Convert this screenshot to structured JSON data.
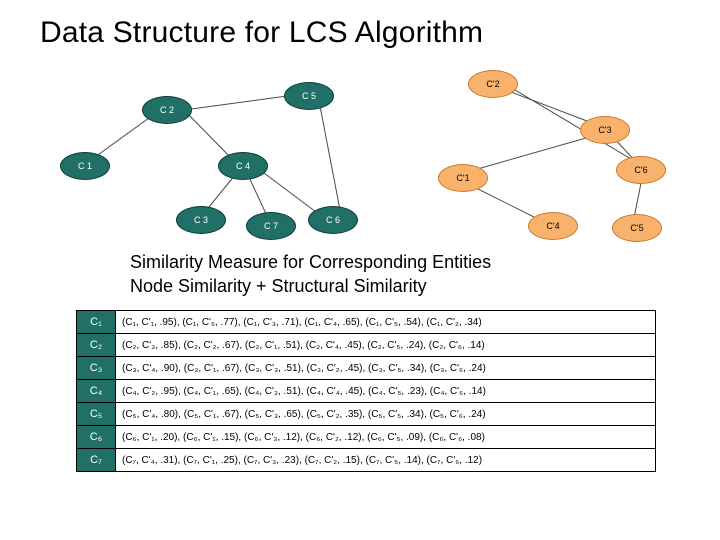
{
  "title": "Data Structure for LCS Algorithm",
  "subtitle_1": "Similarity Measure for Corresponding Entities",
  "subtitle_2": "Node Similarity + Structural Similarity",
  "left_nodes": {
    "c1": "C 1",
    "c2": "C 2",
    "c3": "C 3",
    "c4": "C 4",
    "c5": "C 5",
    "c6": "C 6",
    "c7": "C 7"
  },
  "right_nodes": {
    "c1": "C'1",
    "c2": "C'2",
    "c3": "C'3",
    "c4": "C'4",
    "c5": "C'5",
    "c6": "C'6"
  },
  "table": {
    "rows": [
      {
        "h": "C₁",
        "v": "(C₁, C'₁, .95), (C₁, C'₆, .77), (C₁, C'₃, .71), (C₁, C'₄, .65), (C₁, C'₅, .54), (C₁, C'₂, .34)"
      },
      {
        "h": "C₂",
        "v": "(C₂, C'₃, .85), (C₂, C'₂, .67), (C₂, C'₁, .51), (C₂, C'₄, .45), (C₂, C'₅, .24), (C₂, C'₆, .14)"
      },
      {
        "h": "C₃",
        "v": "(C₃, C'₄, .90), (C₃, C'₁, .67), (C₃, C'₃, .51), (C₃, C'₂, .45), (C₃, C'₅, .34), (C₃, C'₆, .24)"
      },
      {
        "h": "C₄",
        "v": "(C₄, C'₂, .95), (C₄, C'₁, .65), (C₄, C'₃, .51), (C₄, C'₄, .45), (C₄, C'₅, .23), (C₄, C'₆, .14)"
      },
      {
        "h": "C₅",
        "v": "(C₅, C'₄, .80), (C₅, C'₁, .67), (C₅, C'₃, .65), (C₅, C'₂, .35), (C₅, C'₅, .34), (C₅, C'₆, .24)"
      },
      {
        "h": "C₆",
        "v": "(C₆, C'₁, .20), (C₆, C'₁, .15), (C₆, C'₃, .12), (C₆, C'₂, .12), (C₆, C'₅, .09), (C₆, C'₆, .08)"
      },
      {
        "h": "C₇",
        "v": "(C₇, C'₄, .31), (C₇, C'₁, .25), (C₇, C'₃, .23), (C₇, C'₂, .15), (C₇, C'₅, .14), (C₇, C'₆, .12)"
      }
    ]
  },
  "chart_data": {
    "type": "table",
    "title": "LCS similarity scores (node, node', score)",
    "source_nodes": [
      "C1",
      "C2",
      "C3",
      "C4",
      "C5",
      "C6",
      "C7"
    ],
    "target_nodes": [
      "C'1",
      "C'2",
      "C'3",
      "C'4",
      "C'5",
      "C'6"
    ],
    "rows": [
      {
        "source": "C1",
        "ranked": [
          [
            "C'1",
            0.95
          ],
          [
            "C'6",
            0.77
          ],
          [
            "C'3",
            0.71
          ],
          [
            "C'4",
            0.65
          ],
          [
            "C'5",
            0.54
          ],
          [
            "C'2",
            0.34
          ]
        ]
      },
      {
        "source": "C2",
        "ranked": [
          [
            "C'3",
            0.85
          ],
          [
            "C'2",
            0.67
          ],
          [
            "C'1",
            0.51
          ],
          [
            "C'4",
            0.45
          ],
          [
            "C'5",
            0.24
          ],
          [
            "C'6",
            0.14
          ]
        ]
      },
      {
        "source": "C3",
        "ranked": [
          [
            "C'4",
            0.9
          ],
          [
            "C'1",
            0.67
          ],
          [
            "C'3",
            0.51
          ],
          [
            "C'2",
            0.45
          ],
          [
            "C'5",
            0.34
          ],
          [
            "C'6",
            0.24
          ]
        ]
      },
      {
        "source": "C4",
        "ranked": [
          [
            "C'2",
            0.95
          ],
          [
            "C'1",
            0.65
          ],
          [
            "C'3",
            0.51
          ],
          [
            "C'4",
            0.45
          ],
          [
            "C'5",
            0.23
          ],
          [
            "C'6",
            0.14
          ]
        ]
      },
      {
        "source": "C5",
        "ranked": [
          [
            "C'4",
            0.8
          ],
          [
            "C'1",
            0.67
          ],
          [
            "C'3",
            0.65
          ],
          [
            "C'2",
            0.35
          ],
          [
            "C'5",
            0.34
          ],
          [
            "C'6",
            0.24
          ]
        ]
      },
      {
        "source": "C6",
        "ranked": [
          [
            "C'1",
            0.2
          ],
          [
            "C'1",
            0.15
          ],
          [
            "C'3",
            0.12
          ],
          [
            "C'2",
            0.12
          ],
          [
            "C'5",
            0.09
          ],
          [
            "C'6",
            0.08
          ]
        ]
      },
      {
        "source": "C7",
        "ranked": [
          [
            "C'4",
            0.31
          ],
          [
            "C'1",
            0.25
          ],
          [
            "C'3",
            0.23
          ],
          [
            "C'2",
            0.15
          ],
          [
            "C'5",
            0.14
          ],
          [
            "C'6",
            0.12
          ]
        ]
      }
    ],
    "left_graph_edges": [
      [
        "C1",
        "C2"
      ],
      [
        "C2",
        "C4"
      ],
      [
        "C2",
        "C5"
      ],
      [
        "C4",
        "C3"
      ],
      [
        "C4",
        "C7"
      ],
      [
        "C4",
        "C6"
      ],
      [
        "C5",
        "C6"
      ]
    ],
    "right_graph_edges": [
      [
        "C'2",
        "C'3"
      ],
      [
        "C'3",
        "C'1"
      ],
      [
        "C'3",
        "C'6"
      ],
      [
        "C'1",
        "C'4"
      ],
      [
        "C'6",
        "C'5"
      ],
      [
        "C'2",
        "C'6"
      ]
    ]
  }
}
